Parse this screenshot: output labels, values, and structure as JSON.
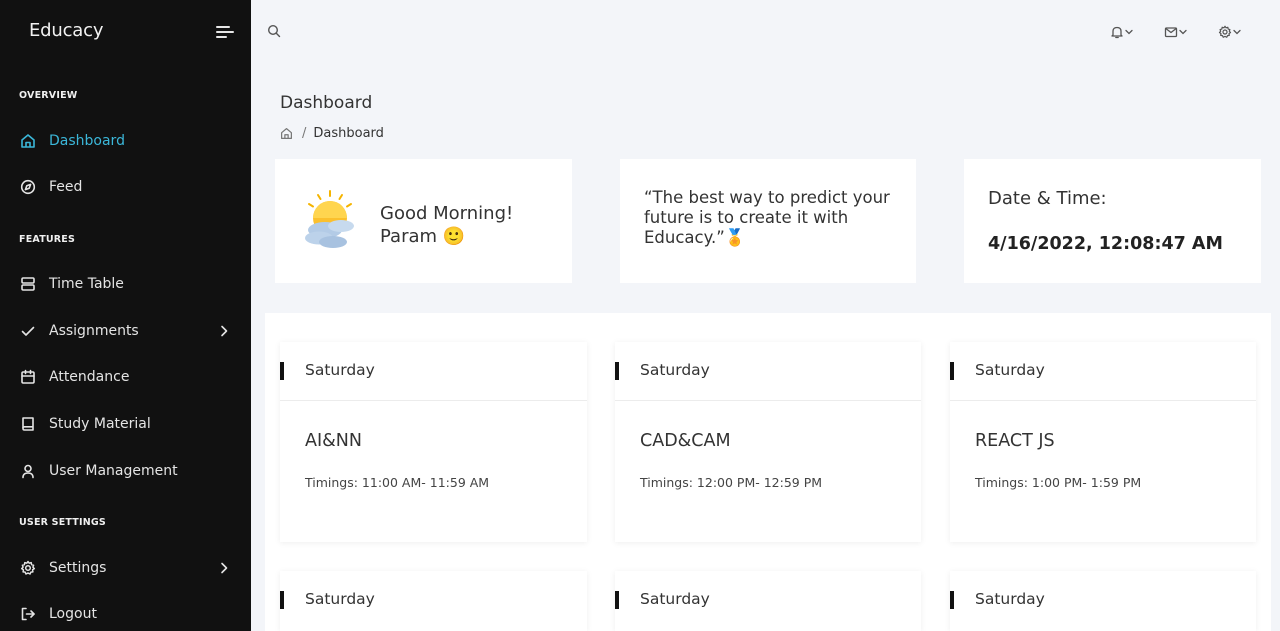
{
  "app": {
    "brand": "Educacy"
  },
  "sidebar": {
    "sections": [
      {
        "title": "OVERVIEW"
      },
      {
        "title": "FEATURES"
      },
      {
        "title": "USER SETTINGS"
      }
    ],
    "items": [
      {
        "label": "Dashboard",
        "icon": "home-icon",
        "active": true
      },
      {
        "label": "Feed",
        "icon": "compass-icon"
      },
      {
        "label": "Time Table",
        "icon": "server-icon"
      },
      {
        "label": "Assignments",
        "icon": "check-icon",
        "has_submenu": true
      },
      {
        "label": "Attendance",
        "icon": "calendar-icon"
      },
      {
        "label": "Study Material",
        "icon": "book-icon"
      },
      {
        "label": "User Management",
        "icon": "user-icon"
      },
      {
        "label": "Settings",
        "icon": "gear-icon",
        "has_submenu": true
      },
      {
        "label": "Logout",
        "icon": "logout-icon"
      }
    ]
  },
  "topbar": {
    "icons": [
      "search-icon",
      "bell-icon",
      "mail-icon",
      "gear-icon"
    ]
  },
  "page": {
    "title": "Dashboard",
    "breadcrumb": {
      "separator": "/",
      "current": "Dashboard"
    }
  },
  "cards": {
    "greeting": {
      "line1": "Good Morning!",
      "name": "Param",
      "emoji": "🙂"
    },
    "quote": {
      "text": "“The best way to predict your future is to create it with Educacy.”",
      "emoji": "🏅"
    },
    "datetime": {
      "label": "Date & Time:",
      "value": "4/16/2022, 12:08:47 AM"
    }
  },
  "schedule": [
    {
      "day": "Saturday",
      "subject": "AI&NN",
      "timing": "Timings: 11:00 AM- 11:59 AM"
    },
    {
      "day": "Saturday",
      "subject": "CAD&CAM",
      "timing": "Timings: 12:00 PM- 12:59 PM"
    },
    {
      "day": "Saturday",
      "subject": "REACT JS",
      "timing": "Timings: 1:00 PM- 1:59 PM"
    },
    {
      "day": "Saturday"
    },
    {
      "day": "Saturday"
    },
    {
      "day": "Saturday"
    }
  ],
  "colors": {
    "sidebar_bg": "#111111",
    "accent": "#3bb7d9",
    "page_bg": "#f3f5f9"
  }
}
